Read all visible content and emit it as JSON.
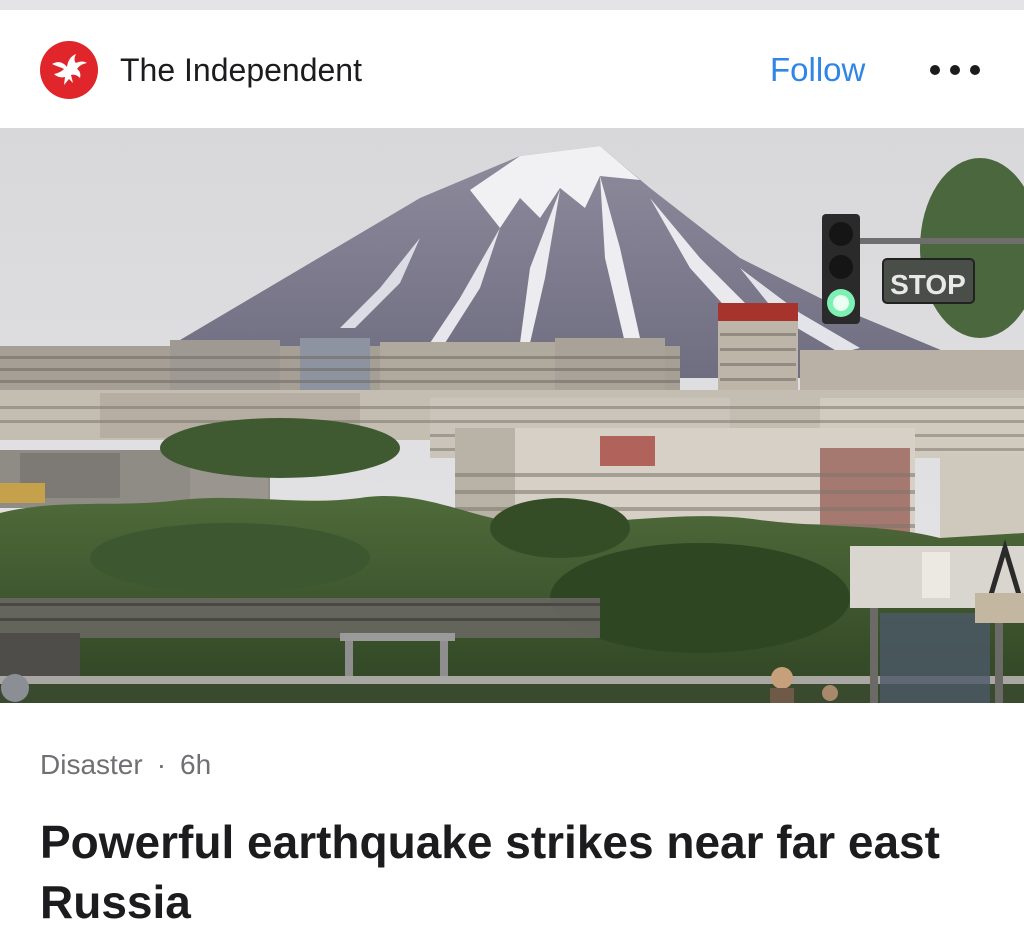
{
  "header": {
    "publisher_name": "The Independent",
    "logo_icon": "eagle-icon",
    "follow_label": "Follow",
    "more_icon": "ellipsis-icon"
  },
  "hero_image": {
    "sign_text": "STOP"
  },
  "article": {
    "category": "Disaster",
    "separator": "·",
    "time_ago": "6h",
    "headline": "Powerful earthquake strikes near far east Russia"
  },
  "colors": {
    "brand_red": "#e0262a",
    "follow_blue": "#2f86e6",
    "meta_gray": "#707074",
    "text_dark": "#1c1c1e"
  }
}
